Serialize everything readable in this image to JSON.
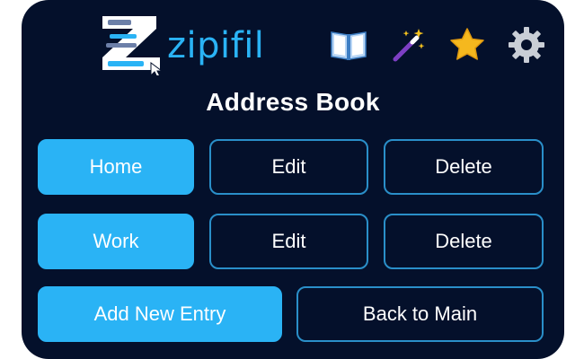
{
  "header": {
    "logo_text": "zipifil",
    "icons": [
      {
        "name": "book-icon",
        "color": "#6aa9e8"
      },
      {
        "name": "magic-wand-icon",
        "color": "#8a4bd6"
      },
      {
        "name": "star-icon",
        "color": "#f5b81e"
      },
      {
        "name": "gear-icon",
        "color": "#c9ced6"
      }
    ]
  },
  "title": "Address Book",
  "entries": [
    {
      "label": "Home",
      "edit_label": "Edit",
      "delete_label": "Delete"
    },
    {
      "label": "Work",
      "edit_label": "Edit",
      "delete_label": "Delete"
    }
  ],
  "footer": {
    "add_label": "Add New Entry",
    "back_label": "Back to Main"
  },
  "colors": {
    "background": "#04102b",
    "accent": "#2ab3f5",
    "outline": "#2a8fc9"
  }
}
